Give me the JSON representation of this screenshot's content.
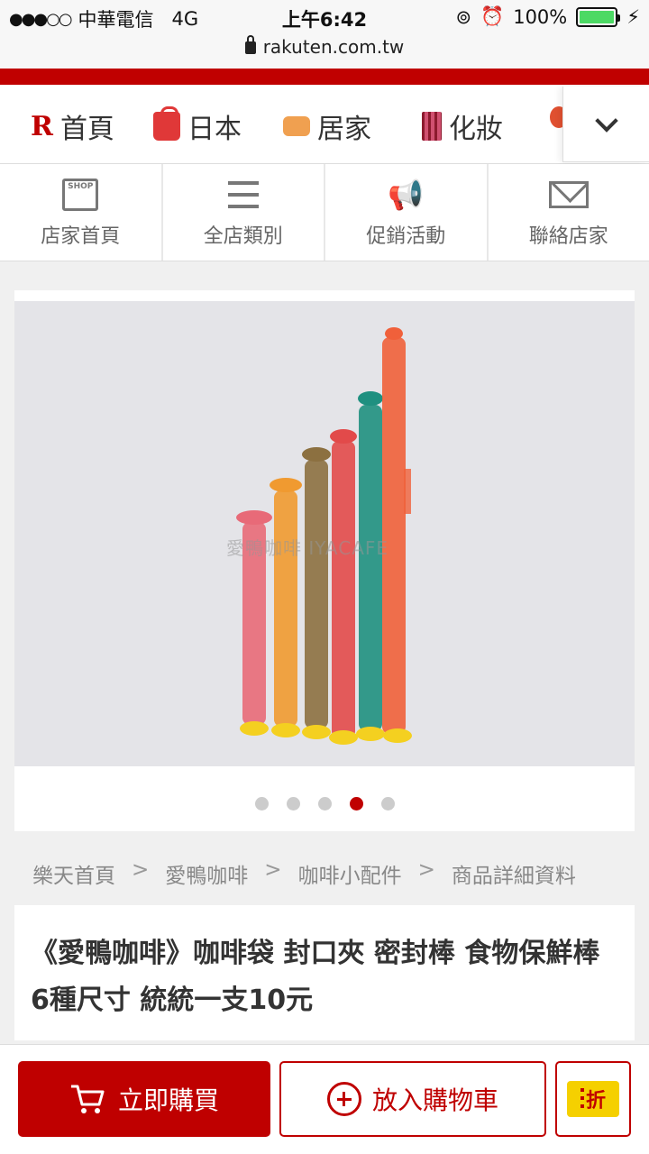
{
  "status_bar": {
    "signal": "●●●○○",
    "carrier": "中華電信",
    "network": "4G",
    "time": "上午6:42",
    "battery": "100%",
    "url": "rakuten.com.tw"
  },
  "category_nav": {
    "items": [
      {
        "label": "首頁",
        "icon": "rakuten-r-icon"
      },
      {
        "label": "日本",
        "icon": "shopping-bag-icon"
      },
      {
        "label": "居家",
        "icon": "sofa-icon"
      },
      {
        "label": "化妝",
        "icon": "cosmetics-icon"
      }
    ]
  },
  "shop_nav": {
    "items": [
      {
        "label": "店家首頁",
        "icon": "shop-icon",
        "icon_text": "SHOP"
      },
      {
        "label": "全店類別",
        "icon": "list-icon"
      },
      {
        "label": "促銷活動",
        "icon": "megaphone-icon"
      },
      {
        "label": "聯絡店家",
        "icon": "mail-icon"
      }
    ]
  },
  "gallery": {
    "watermark": "愛鴨咖啡 IYACAFE",
    "dot_count": 5,
    "active_index": 3
  },
  "breadcrumb": {
    "items": [
      "樂天首頁",
      "愛鴨咖啡",
      "咖啡小配件",
      "商品詳細資料"
    ],
    "separator": ">"
  },
  "product": {
    "title": "《愛鴨咖啡》咖啡袋 封口夾 密封棒 食物保鮮棒 6種尺寸 統統一支10元"
  },
  "actions": {
    "buy_now": "立即購買",
    "add_to_cart": "放入購物車",
    "coupon": "折"
  },
  "colors": {
    "brand_red": "#bf0000",
    "battery_green": "#4cd964",
    "coupon_yellow": "#f5d000"
  }
}
